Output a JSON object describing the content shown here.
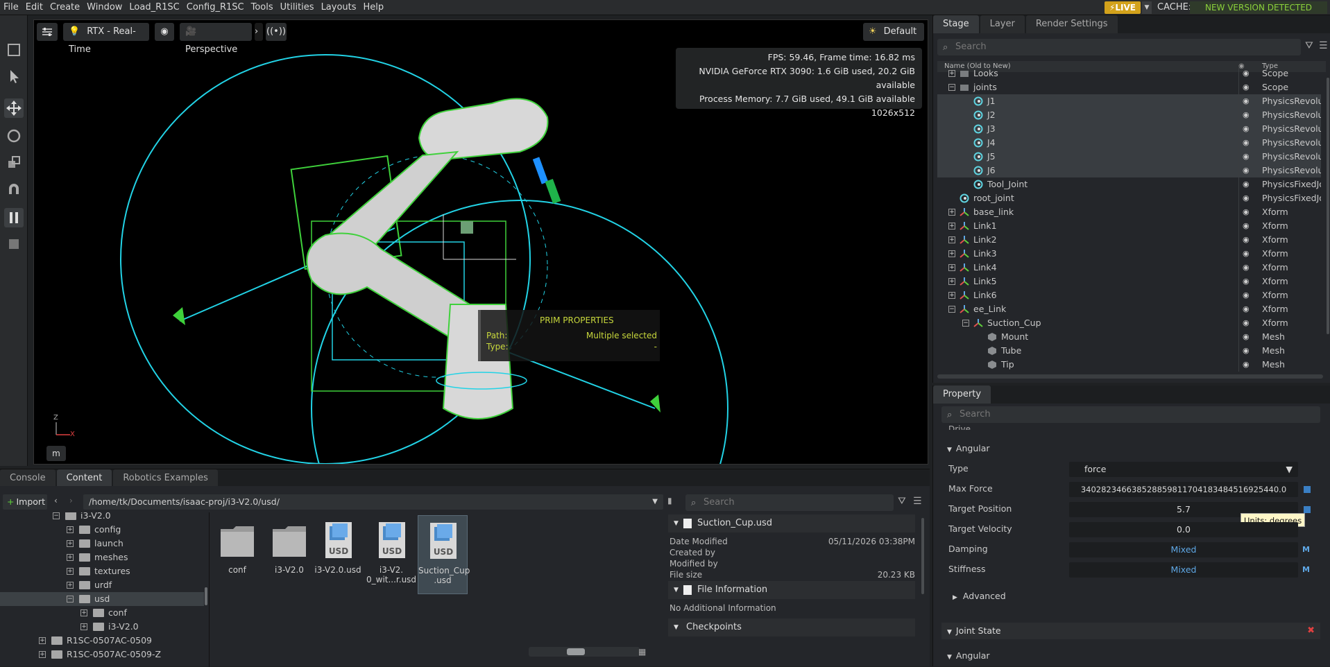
{
  "menu": [
    "File",
    "Edit",
    "Create",
    "Window",
    "Load_R1SC",
    "Config_R1SC",
    "Tools",
    "Utilities",
    "Layouts",
    "Help"
  ],
  "status": {
    "live": "LIVE",
    "cache_label": "CACHE:",
    "new_version": "NEW VERSION DETECTED"
  },
  "viewport": {
    "render_mode": "RTX - Real-Time",
    "camera": "Perspective",
    "lighting": "Default",
    "stats": [
      "FPS: 59.46, Frame time: 16.82 ms",
      "NVIDIA GeForce RTX 3090: 1.6 GiB used, 20.2 GiB available",
      "Process Memory: 7.7 GiB used, 49.1 GiB available",
      "1026x512"
    ],
    "prim_props": {
      "title": "PRIM PROPERTIES",
      "path_label": "Path:",
      "path_value": "Multiple selected",
      "type_label": "Type:",
      "type_value": "-"
    },
    "axis_z": "Z",
    "axis_x": "X",
    "units_btn": "m"
  },
  "stage": {
    "tabs": [
      "Stage",
      "Layer",
      "Render Settings"
    ],
    "search_placeholder": "Search",
    "col_name": "Name (Old to New)",
    "col_type": "Type",
    "rows": [
      {
        "name": "Looks",
        "type": "Scope"
      },
      {
        "name": "joints",
        "type": "Scope"
      },
      {
        "name": "J1",
        "type": "PhysicsRevoluteJoint"
      },
      {
        "name": "J2",
        "type": "PhysicsRevoluteJoint"
      },
      {
        "name": "J3",
        "type": "PhysicsRevoluteJoint"
      },
      {
        "name": "J4",
        "type": "PhysicsRevoluteJoint"
      },
      {
        "name": "J5",
        "type": "PhysicsRevoluteJoint"
      },
      {
        "name": "J6",
        "type": "PhysicsRevoluteJoint"
      },
      {
        "name": "Tool_Joint",
        "type": "PhysicsFixedJoint"
      },
      {
        "name": "root_joint",
        "type": "PhysicsFixedJoint"
      },
      {
        "name": "base_link",
        "type": "Xform"
      },
      {
        "name": "Link1",
        "type": "Xform"
      },
      {
        "name": "Link2",
        "type": "Xform"
      },
      {
        "name": "Link3",
        "type": "Xform"
      },
      {
        "name": "Link4",
        "type": "Xform"
      },
      {
        "name": "Link5",
        "type": "Xform"
      },
      {
        "name": "Link6",
        "type": "Xform"
      },
      {
        "name": "ee_Link",
        "type": "Xform"
      },
      {
        "name": "Suction_Cup",
        "type": "Xform"
      },
      {
        "name": "Mount",
        "type": "Mesh"
      },
      {
        "name": "Tube",
        "type": "Mesh"
      },
      {
        "name": "Tip",
        "type": "Mesh"
      }
    ]
  },
  "property": {
    "tab": "Property",
    "search_placeholder": "Search",
    "drive_label": "Drive",
    "angular_label": "Angular",
    "fields": [
      {
        "label": "Type",
        "value": "force"
      },
      {
        "label": "Max Force",
        "value": "340282346638528859811704183484516925440.0"
      },
      {
        "label": "Target Position",
        "value": "5.7"
      },
      {
        "label": "Target Velocity",
        "value": "0.0"
      },
      {
        "label": "Damping",
        "value": "Mixed"
      },
      {
        "label": "Stiffness",
        "value": "Mixed"
      }
    ],
    "tooltip": "Units: degrees",
    "mixed_badge": "M",
    "advanced": "Advanced",
    "joint_state": "Joint State",
    "js_angular": "Angular"
  },
  "bottom": {
    "tabs": [
      "Console",
      "Content",
      "Robotics Examples"
    ],
    "import": "Import",
    "path": "/home/tk/Documents/isaac-proj/i3-V2.0/usd/",
    "search_placeholder": "Search",
    "tree": [
      {
        "name": "i3-V2.0",
        "indent": 0,
        "expand": "−"
      },
      {
        "name": "config",
        "indent": 1,
        "expand": "+"
      },
      {
        "name": "launch",
        "indent": 1,
        "expand": "+"
      },
      {
        "name": "meshes",
        "indent": 1,
        "expand": "+"
      },
      {
        "name": "textures",
        "indent": 1,
        "expand": "+"
      },
      {
        "name": "urdf",
        "indent": 1,
        "expand": "+"
      },
      {
        "name": "usd",
        "indent": 1,
        "expand": "−"
      },
      {
        "name": "conf",
        "indent": 2,
        "expand": "+"
      },
      {
        "name": "i3-V2.0",
        "indent": 2,
        "expand": "+"
      },
      {
        "name": "R1SC-0507AC-0509",
        "indent": -1,
        "expand": "+"
      },
      {
        "name": "R1SC-0507AC-0509-Z",
        "indent": -1,
        "expand": "+"
      }
    ],
    "files": [
      {
        "name": "conf",
        "kind": "folder"
      },
      {
        "name": "i3-V2.0",
        "kind": "folder"
      },
      {
        "name": "i3-V2.0.usd",
        "kind": "usd"
      },
      {
        "name": "i3-V2.\n0_wit...r.usd",
        "kind": "usd"
      },
      {
        "name": "Suction_Cup\n.usd",
        "kind": "usd"
      }
    ],
    "details": {
      "file_title": "Suction_Cup.usd",
      "date_modified_label": "Date Modified",
      "date_modified": "05/11/2026 03:38PM",
      "created_by_label": "Created by",
      "modified_by_label": "Modified by",
      "file_size_label": "File size",
      "file_size": "20.23 KB",
      "file_info": "File Information",
      "no_info": "No Additional Information",
      "checkpoints": "Checkpoints"
    }
  },
  "colors": {
    "accent_live": "#d3a21b",
    "new_version": "#8bd13b",
    "cyan_gizmo": "#22d3e6",
    "green_collider": "#3fd13b",
    "mixed": "#5fa8e6"
  }
}
